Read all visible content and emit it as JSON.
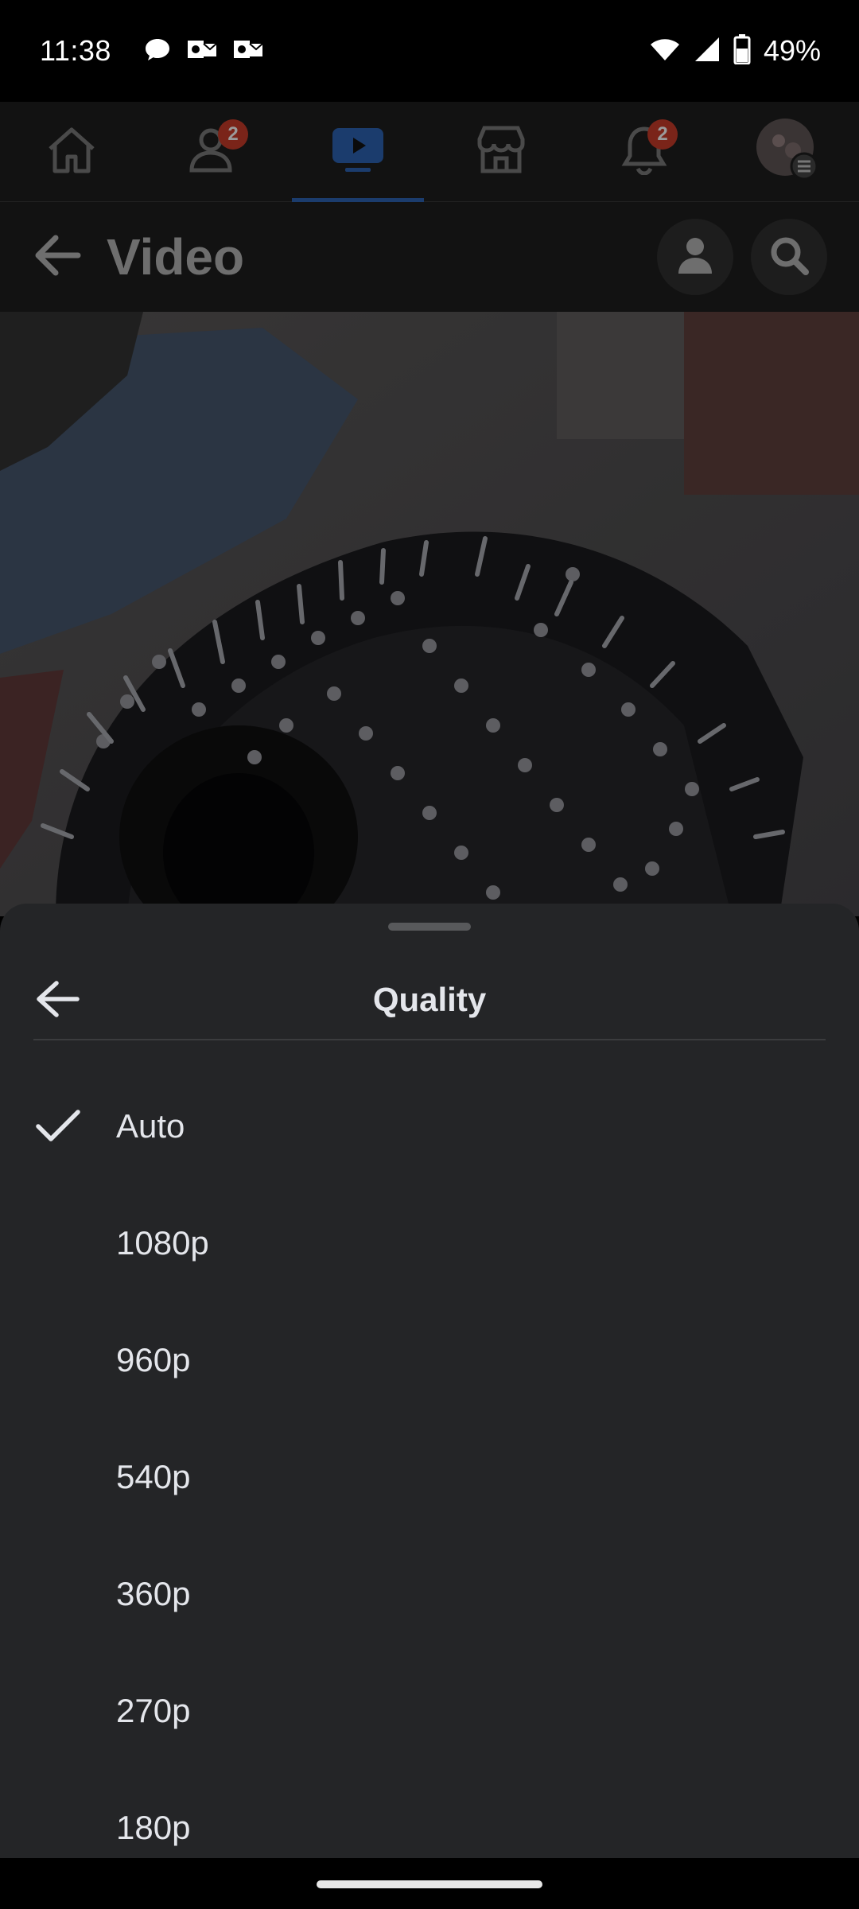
{
  "status_bar": {
    "time": "11:38",
    "battery_percent": "49%",
    "icons": [
      "chat-bubble-icon",
      "outlook-icon",
      "outlook-icon",
      "wifi-icon",
      "cell-signal-icon",
      "battery-icon"
    ]
  },
  "nav": {
    "items": [
      {
        "icon": "home-icon"
      },
      {
        "icon": "friends-icon",
        "badge": "2"
      },
      {
        "icon": "video-icon",
        "active": true
      },
      {
        "icon": "marketplace-icon"
      },
      {
        "icon": "bell-icon",
        "badge": "2"
      },
      {
        "icon": "profile-menu-icon"
      }
    ]
  },
  "header": {
    "title": "Video"
  },
  "sheet": {
    "title": "Quality",
    "options": [
      {
        "label": "Auto",
        "selected": true
      },
      {
        "label": "1080p"
      },
      {
        "label": "960p"
      },
      {
        "label": "540p"
      },
      {
        "label": "360p"
      },
      {
        "label": "270p"
      },
      {
        "label": "180p"
      }
    ]
  },
  "colors": {
    "sheet_bg": "#242527",
    "text": "#e4e6eb",
    "active_tab": "#1b3c6d",
    "badge": "#7a2419"
  }
}
